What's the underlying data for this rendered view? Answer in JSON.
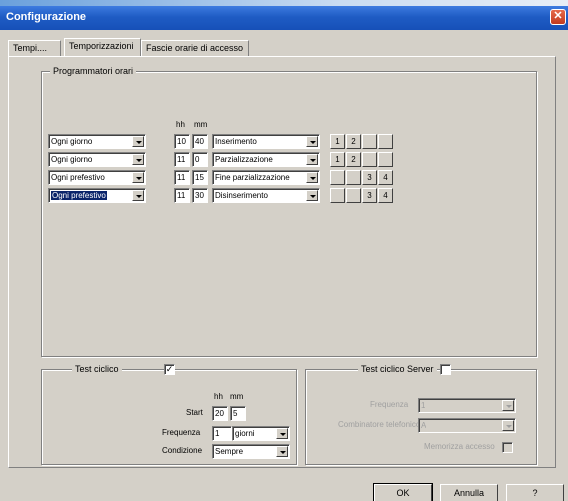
{
  "window": {
    "title": "Configurazione",
    "close_symbol": "✕"
  },
  "tabs": [
    "Tempi....",
    "Temporizzazioni",
    "Fascie orarie di accesso"
  ],
  "programmers": {
    "title": "Programmatori orari",
    "hh_label": "hh",
    "mm_label": "mm",
    "rows": [
      {
        "day": "Ogni giorno",
        "hh": "10",
        "mm": "40",
        "action": "Inserimento",
        "buttons": [
          "1",
          "2",
          "",
          ""
        ]
      },
      {
        "day": "Ogni giorno",
        "hh": "11",
        "mm": "0",
        "action": "Parzializzazione",
        "buttons": [
          "1",
          "2",
          "",
          ""
        ]
      },
      {
        "day": "Ogni prefestivo",
        "hh": "11",
        "mm": "15",
        "action": "Fine parzializzazione",
        "buttons": [
          "",
          "",
          "3",
          "4"
        ]
      },
      {
        "day": "Ogni prefestivo",
        "hh": "11",
        "mm": "30",
        "action": "Disinserimento",
        "buttons": [
          "",
          "",
          "3",
          "4"
        ],
        "selected": true
      }
    ]
  },
  "test_ciclico": {
    "title": "Test ciclico",
    "checked": true,
    "check_symbol": "✓",
    "hh_label": "hh",
    "mm_label": "mm",
    "start_label": "Start",
    "start_hh": "20",
    "start_mm": "5",
    "frequenza_label": "Frequenza",
    "frequenza_value": "1",
    "frequenza_unit": "giorni",
    "condizione_label": "Condizione",
    "condizione_value": "Sempre"
  },
  "test_server": {
    "title": "Test ciclico Server",
    "checked": false,
    "frequenza_label": "Frequenza",
    "frequenza_value": "1",
    "combinatore_label": "Combinatore telefonico",
    "combinatore_value": "A",
    "memorizza_label": "Memorizza accesso"
  },
  "buttons": {
    "ok": "OK",
    "annulla": "Annulla",
    "help": "?"
  }
}
